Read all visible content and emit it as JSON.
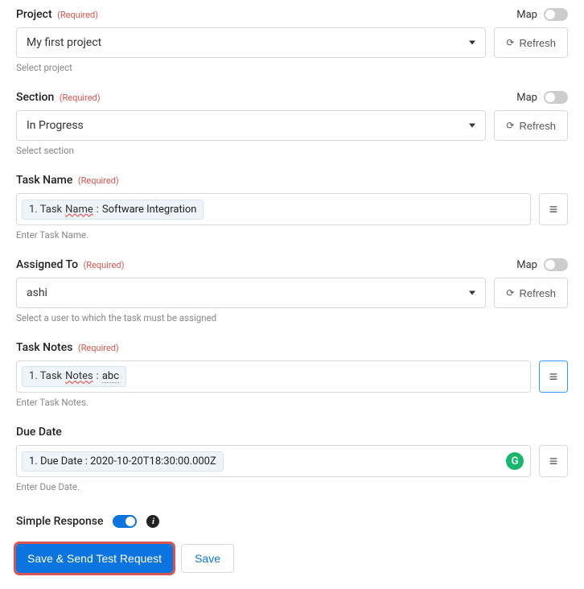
{
  "labels": {
    "required": "(Required)",
    "map": "Map",
    "refresh": "Refresh"
  },
  "project": {
    "label": "Project",
    "value": "My first project",
    "help": "Select project"
  },
  "section": {
    "label": "Section",
    "value": "In Progress",
    "help": "Select section"
  },
  "taskName": {
    "label": "Task Name",
    "tokenPrefix": "1. Task",
    "tokenWord": "Name",
    "tokenColon": ":",
    "tokenValue": "Software Integration",
    "help": "Enter Task Name."
  },
  "assignedTo": {
    "label": "Assigned To",
    "value": "ashi",
    "help": "Select a user to which the task must be assigned"
  },
  "taskNotes": {
    "label": "Task Notes",
    "tokenPrefix": "1. Task",
    "tokenWord": "Notes",
    "tokenColon": ":",
    "tokenValue": "abc",
    "help": "Enter Task Notes."
  },
  "dueDate": {
    "label": "Due Date",
    "token": "1. Due Date : 2020-10-20T18:30:00.000Z",
    "help": "Enter Due Date.",
    "badge": "G"
  },
  "simpleResponse": {
    "label": "Simple Response"
  },
  "actions": {
    "saveSend": "Save & Send Test Request",
    "save": "Save"
  }
}
